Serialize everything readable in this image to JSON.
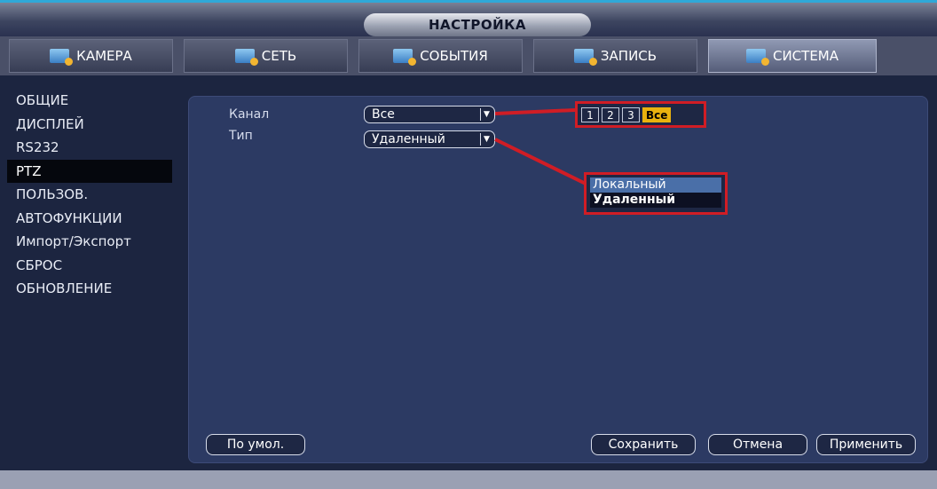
{
  "window": {
    "title": "НАСТРОЙКА"
  },
  "tabs": [
    {
      "label": "КАМЕРА",
      "icon": "camera-icon"
    },
    {
      "label": "СЕТЬ",
      "icon": "network-icon"
    },
    {
      "label": "СОБЫТИЯ",
      "icon": "events-icon"
    },
    {
      "label": "ЗАПИСЬ",
      "icon": "record-icon"
    },
    {
      "label": "СИСТЕМА",
      "icon": "system-icon",
      "active": true
    }
  ],
  "sidebar": {
    "items": [
      {
        "label": "ОБЩИЕ"
      },
      {
        "label": "ДИСПЛЕЙ"
      },
      {
        "label": "RS232"
      },
      {
        "label": "PTZ",
        "active": true
      },
      {
        "label": "ПОЛЬЗОВ."
      },
      {
        "label": "АВТОФУНКЦИИ"
      },
      {
        "label": "Импорт/Экспорт"
      },
      {
        "label": "СБРОС"
      },
      {
        "label": "ОБНОВЛЕНИЕ"
      }
    ]
  },
  "form": {
    "channel_label": "Канал",
    "channel_value": "Все",
    "type_label": "Тип",
    "type_value": "Удаленный"
  },
  "channel_picker": {
    "options": [
      "1",
      "2",
      "3",
      "Все"
    ],
    "selected": "Все"
  },
  "type_dropdown": {
    "options": [
      "Локальный",
      "Удаленный"
    ],
    "selected": "Удаленный"
  },
  "buttons": {
    "default": "По умол.",
    "save": "Сохранить",
    "cancel": "Отмена",
    "apply": "Применить"
  },
  "colors": {
    "highlight": "#d01d25",
    "selected_channel": "#e9b20e",
    "accent_line": "#2fa8d8"
  }
}
